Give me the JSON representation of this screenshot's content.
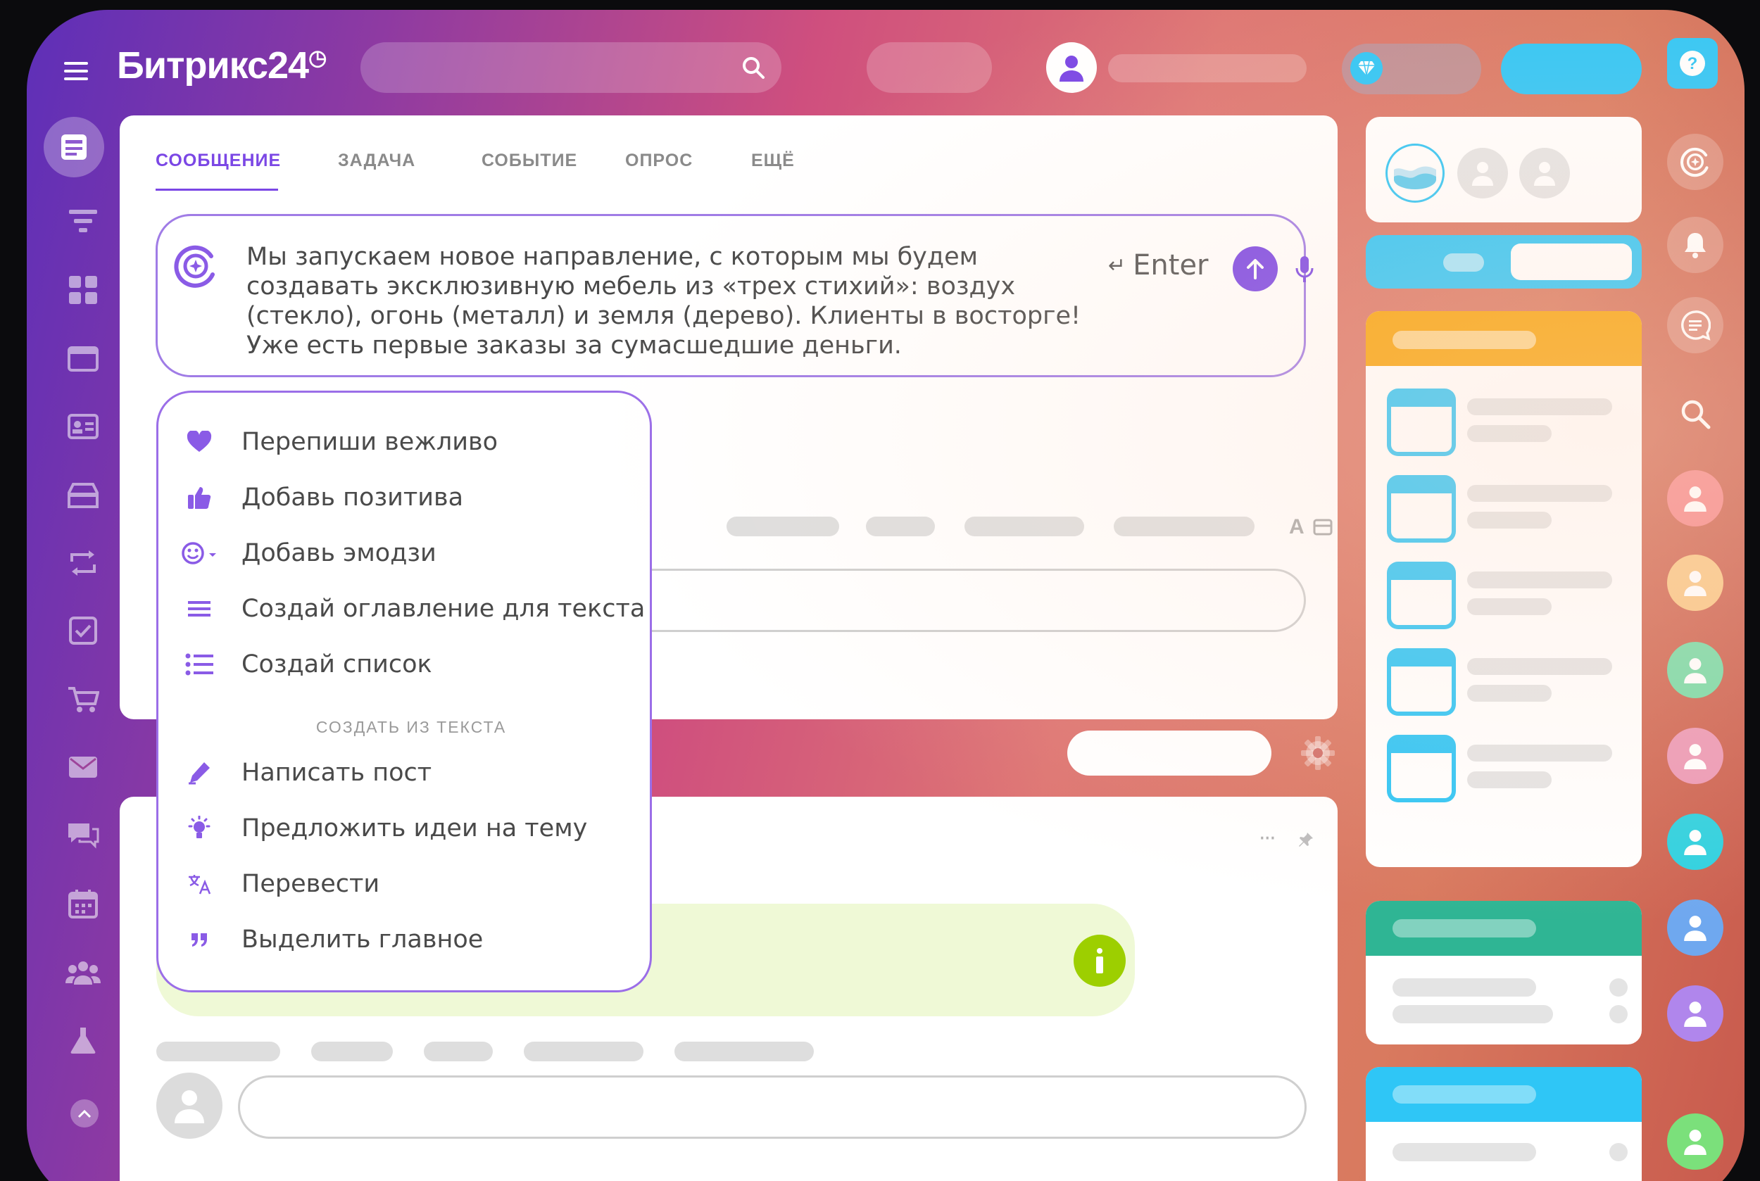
{
  "header": {
    "logo": "Битрикс24",
    "logo_clock": "◷"
  },
  "tabs": [
    {
      "label": "СООБЩЕНИЕ",
      "active": true
    },
    {
      "label": "ЗАДАЧА"
    },
    {
      "label": "СОБЫТИЕ"
    },
    {
      "label": "ОПРОС"
    },
    {
      "label": "ЕЩЁ"
    }
  ],
  "composer": {
    "text": "Мы запускаем новое направление, с которым мы будем создавать эксклюзивную мебель из  «трех стихий»: воздух (стекло), огонь (металл) и земля (дерево). Клиенты в  восторге! Уже есть первые заказы за сумасшедшие деньги.",
    "send_hint": "Enter",
    "send_hint_glyph": "↵"
  },
  "ai_menu": {
    "items": [
      {
        "label": "Перепиши вежливо",
        "icon": "heart-icon"
      },
      {
        "label": "Добавь позитива",
        "icon": "thumbs-up-icon"
      },
      {
        "label": "Добавь эмодзи",
        "icon": "emoji-icon"
      },
      {
        "label": "Создай оглавление для текста",
        "icon": "lines-icon"
      },
      {
        "label": "Создай список",
        "icon": "list-icon"
      }
    ],
    "section_title": "СОЗДАТЬ ИЗ ТЕКСТА",
    "items2": [
      {
        "label": "Написать пост",
        "icon": "pen-icon"
      },
      {
        "label": "Предложить идеи на тему",
        "icon": "bulb-icon"
      },
      {
        "label": "Перевести",
        "icon": "translate-icon"
      },
      {
        "label": "Выделить главное",
        "icon": "quote-icon"
      }
    ]
  },
  "toolbar": {
    "font_glyph": "A"
  },
  "post": {
    "more_glyph": "···"
  },
  "colors": {
    "accent": "#7b47e5",
    "blue": "#2fc6f6",
    "orange": "#f7a40c",
    "green": "#2fb594",
    "info": "#9dcf00"
  }
}
